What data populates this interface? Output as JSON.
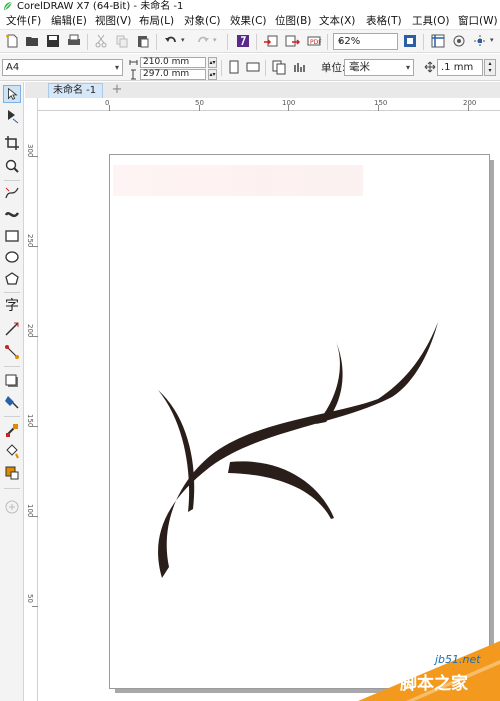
{
  "window": {
    "title": "CorelDRAW X7 (64-Bit) - 未命名 -1"
  },
  "menu": [
    "文件(F)",
    "编辑(E)",
    "视图(V)",
    "布局(L)",
    "对象(C)",
    "效果(C)",
    "位图(B)",
    "文本(X)",
    "表格(T)",
    "工具(O)",
    "窗口(W)"
  ],
  "toolbar": {
    "zoom": "62%"
  },
  "property_bar": {
    "paper": "A4",
    "width": "210.0 mm",
    "height": "297.0 mm",
    "unit_label": "单位:",
    "unit": "毫米",
    "nudge": ".1 mm"
  },
  "document": {
    "tab": "未命名 -1"
  },
  "rulers": {
    "horizontal": [
      "0",
      "50",
      "100",
      "150",
      "200"
    ],
    "vertical": [
      "300",
      "250",
      "200",
      "150",
      "100",
      "50"
    ]
  },
  "watermark": {
    "url": "jb51.net",
    "site": "脚本之家"
  },
  "colors": {
    "accent": "#1a6fb3",
    "brand_green": "#3bb54a",
    "drawing": "#2a1e1a"
  }
}
